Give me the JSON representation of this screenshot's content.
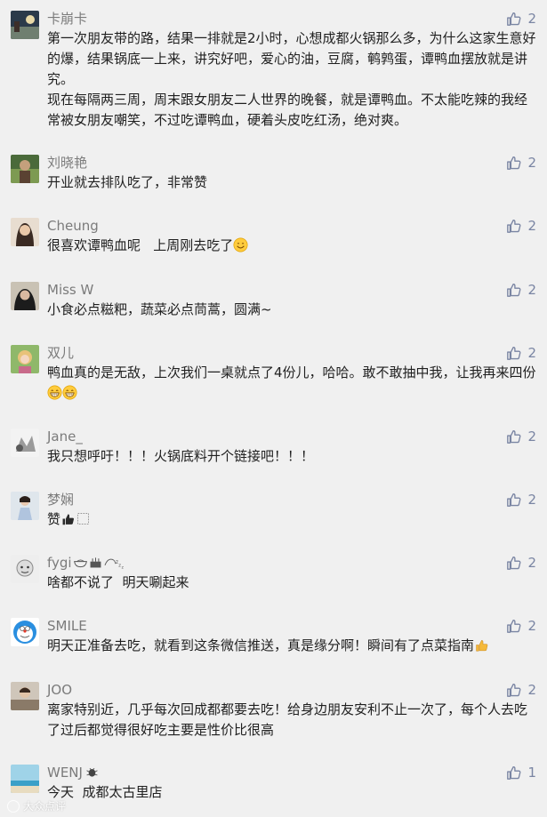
{
  "comments": [
    {
      "name": "卡崩卡",
      "likes": "2",
      "text": "第一次朋友带的路，结果一排就是2小时，心想成都火锅那么多，为什么这家生意好的爆，结果锅底一上来，讲究好吧，爱心的油，豆腐，鹌鹑蛋，谭鸭血摆放就是讲究。\n现在每隔两三周，周末跟女朋友二人世界的晚餐，就是谭鸭血。不太能吃辣的我经常被女朋友嘲笑，不过吃谭鸭血，硬着头皮吃红汤，绝对爽。"
    },
    {
      "name": "刘晓艳",
      "likes": "2",
      "text": "开业就去排队吃了，非常赞"
    },
    {
      "name": "Cheung",
      "likes": "2",
      "text": "很喜欢谭鸭血呢   上周刚去吃了"
    },
    {
      "name": "Miss W",
      "likes": "2",
      "text": "小食必点糍粑，蔬菜必点茼蒿，圆满~"
    },
    {
      "name": "双儿",
      "likes": "2",
      "text": "鸭血真的是无敌，上次我们一桌就点了4份儿，哈哈。敢不敢抽中我，让我再来四份"
    },
    {
      "name": "Jane_",
      "likes": "2",
      "text": "我只想呼吁！！！火锅底料开个链接吧！！！"
    },
    {
      "name": "梦娴",
      "likes": "2",
      "text": "赞"
    },
    {
      "name": "fygi",
      "likes": "2",
      "text": "啥都不说了  明天唰起来"
    },
    {
      "name": "SMILE",
      "likes": "2",
      "text": "明天正准备去吃，就看到这条微信推送，真是缘分啊！瞬间有了点菜指南"
    },
    {
      "name": "JOO",
      "likes": "2",
      "text": "离家特别近，几乎每次回成都都要去吃！给身边朋友安利不止一次了，每个人去吃了过后都觉得很好吃主要是性价比很高"
    },
    {
      "name": "WENJ",
      "likes": "1",
      "text": "今天  成都太古里店"
    }
  ],
  "watermark": "大众点评",
  "colors": {
    "background": "#f0f0f0",
    "name": "#7b7b7b",
    "like": "#7a85a3",
    "text": "#1f1f1f"
  },
  "icons": {
    "like": "thumbs-up-icon",
    "smile": "smile-emoji-icon",
    "grin": "grin-emoji-icon",
    "thumb": "thumbs-up-emoji-icon"
  }
}
